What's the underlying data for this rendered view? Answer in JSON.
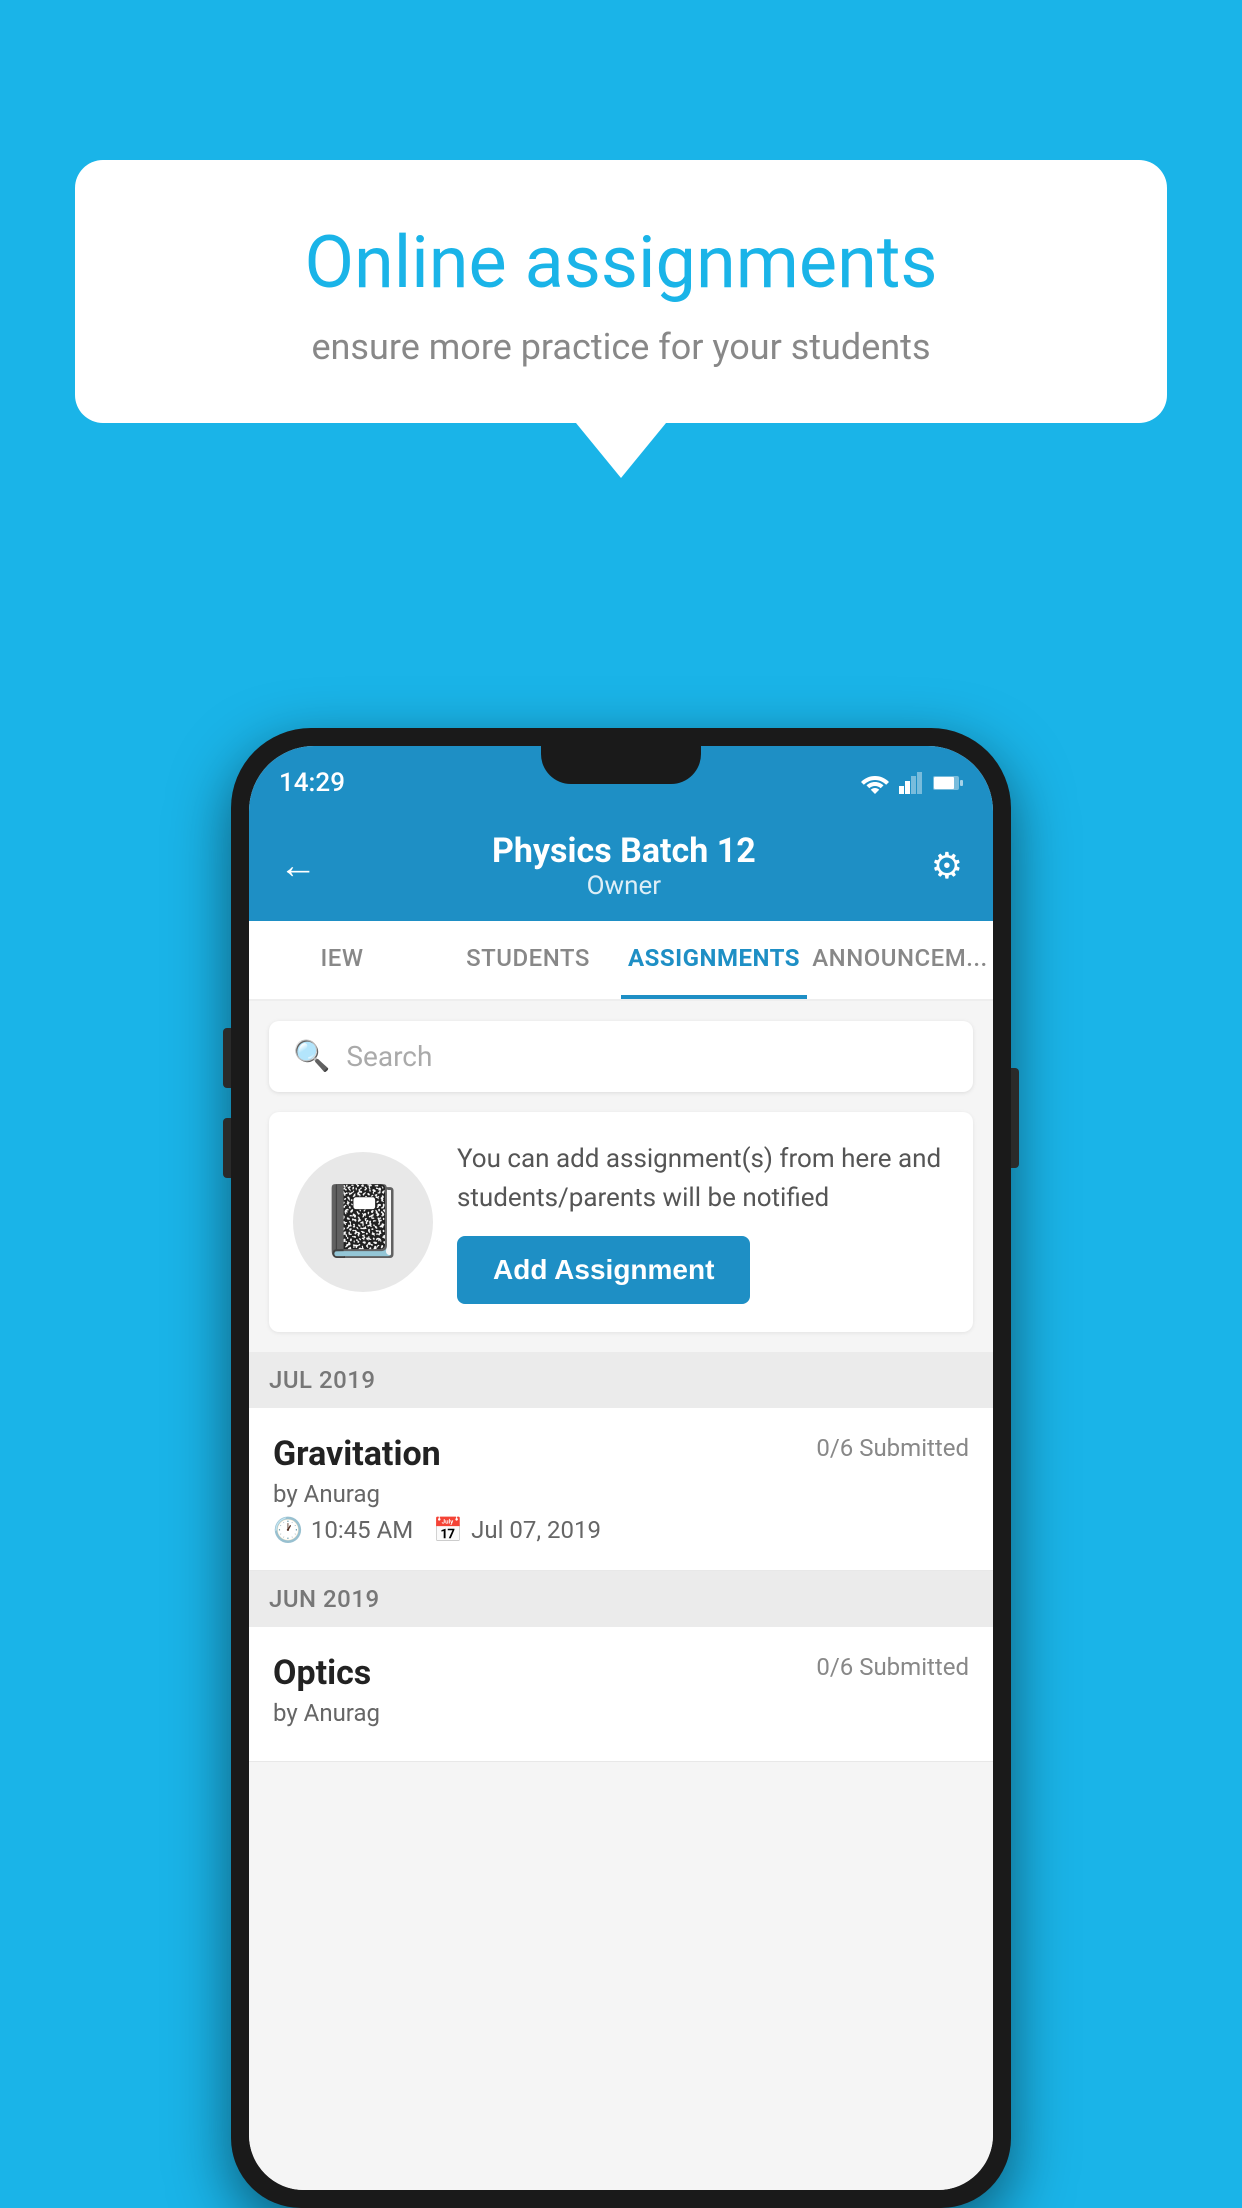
{
  "background": {
    "color": "#1ab4e8"
  },
  "speech_bubble": {
    "title": "Online assignments",
    "subtitle": "ensure more practice for your students"
  },
  "status_bar": {
    "time": "14:29"
  },
  "header": {
    "title": "Physics Batch 12",
    "subtitle": "Owner",
    "back_label": "←",
    "gear_label": "⚙"
  },
  "tabs": [
    {
      "label": "IEW",
      "active": false
    },
    {
      "label": "STUDENTS",
      "active": false
    },
    {
      "label": "ASSIGNMENTS",
      "active": true
    },
    {
      "label": "ANNOUNCEM...",
      "active": false
    }
  ],
  "search": {
    "placeholder": "Search"
  },
  "info_card": {
    "description": "You can add assignment(s) from here and students/parents will be notified",
    "button_label": "Add Assignment"
  },
  "sections": [
    {
      "label": "JUL 2019",
      "assignments": [
        {
          "name": "Gravitation",
          "submitted": "0/6 Submitted",
          "by": "by Anurag",
          "time": "10:45 AM",
          "date": "Jul 07, 2019"
        }
      ]
    },
    {
      "label": "JUN 2019",
      "assignments": [
        {
          "name": "Optics",
          "submitted": "0/6 Submitted",
          "by": "by Anurag",
          "time": "",
          "date": ""
        }
      ]
    }
  ]
}
